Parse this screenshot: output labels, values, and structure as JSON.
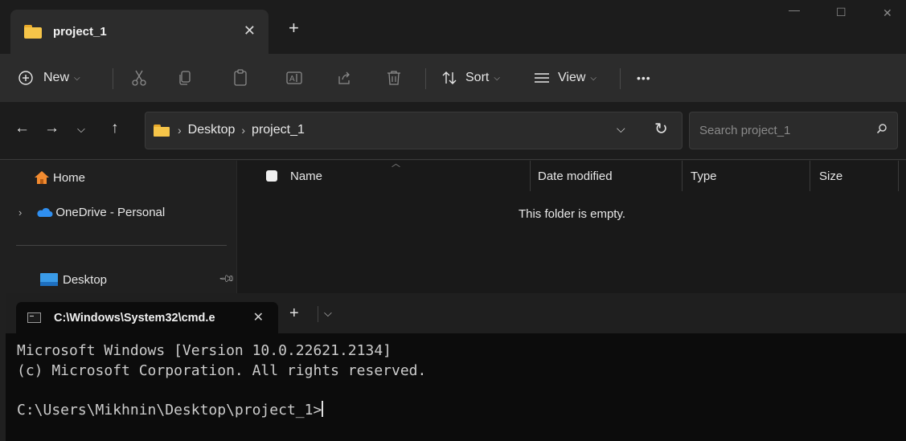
{
  "explorer": {
    "tab": {
      "title": "project_1",
      "close": "✕"
    },
    "new_tab": "+",
    "window_controls": {
      "minimize": "—",
      "maximize": "☐",
      "close": "✕"
    },
    "toolbar": {
      "new_label": "New",
      "sort_label": "Sort",
      "view_label": "View",
      "more": "•••",
      "icons": [
        "cut-icon",
        "copy-icon",
        "paste-icon",
        "rename-icon",
        "share-icon",
        "delete-icon"
      ]
    },
    "address": {
      "crumbs": [
        "Desktop",
        "project_1"
      ],
      "search_placeholder": "Search project_1"
    },
    "sidebar": {
      "items": [
        {
          "label": "Home",
          "icon": "home-icon"
        },
        {
          "label": "OneDrive - Personal",
          "icon": "cloud-icon"
        },
        {
          "label": "Desktop",
          "icon": "desktop-icon"
        }
      ]
    },
    "columns": [
      "Name",
      "Date modified",
      "Type",
      "Size"
    ],
    "empty_message": "This folder is empty."
  },
  "terminal": {
    "tab_title": "C:\\Windows\\System32\\cmd.e",
    "tab_close": "✕",
    "new_tab": "+",
    "lines": [
      "Microsoft Windows [Version 10.0.22621.2134]",
      "(c) Microsoft Corporation. All rights reserved.",
      "",
      "C:\\Users\\Mikhnin\\Desktop\\project_1>"
    ]
  },
  "colors": {
    "folder": "#f6c549",
    "home": "#f28b30",
    "onedrive": "#2f8ff0",
    "desktop": "#3a9be8"
  }
}
